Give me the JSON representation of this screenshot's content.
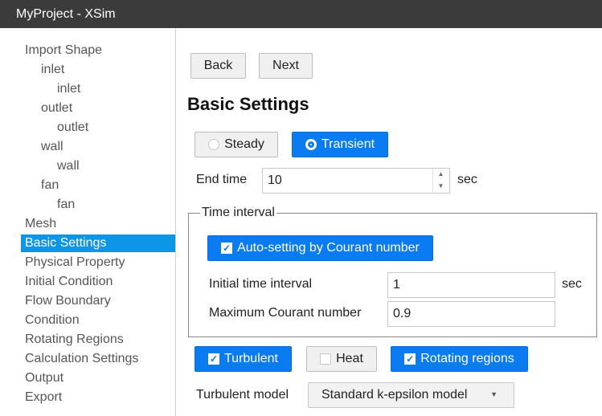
{
  "window": {
    "title": "MyProject - XSim"
  },
  "sidebar": {
    "items": [
      {
        "label": "Import Shape"
      },
      {
        "label": "inlet"
      },
      {
        "label": "inlet"
      },
      {
        "label": "outlet"
      },
      {
        "label": "outlet"
      },
      {
        "label": "wall"
      },
      {
        "label": "wall"
      },
      {
        "label": "fan"
      },
      {
        "label": "fan"
      },
      {
        "label": "Mesh"
      },
      {
        "label": "Basic Settings"
      },
      {
        "label": "Physical Property"
      },
      {
        "label": "Initial Condition"
      },
      {
        "label": "Flow Boundary"
      },
      {
        "label": "Condition"
      },
      {
        "label": "Rotating Regions"
      },
      {
        "label": "Calculation Settings"
      },
      {
        "label": "Output"
      },
      {
        "label": "Export"
      }
    ]
  },
  "nav": {
    "back_label": "Back",
    "next_label": "Next"
  },
  "page": {
    "title": "Basic Settings"
  },
  "mode": {
    "steady_label": "Steady",
    "transient_label": "Transient",
    "selected": "Transient"
  },
  "end_time": {
    "label": "End time",
    "value": "10",
    "unit": "sec"
  },
  "time_interval": {
    "legend": "Time interval",
    "auto_label": "Auto-setting by Courant number",
    "auto_checked": true,
    "initial_label": "Initial time interval",
    "initial_value": "1",
    "initial_unit": "sec",
    "courant_label": "Maximum Courant number",
    "courant_value": "0.9"
  },
  "options": {
    "turbulent_label": "Turbulent",
    "turbulent_checked": true,
    "heat_label": "Heat",
    "heat_checked": false,
    "rotating_label": "Rotating regions",
    "rotating_checked": true
  },
  "turbulent_model": {
    "label": "Turbulent model",
    "selected": "Standard k-epsilon model"
  },
  "colors": {
    "accent": "#0a7bf0",
    "selection": "#0d95e8",
    "titlebar": "#3b3b3b"
  }
}
